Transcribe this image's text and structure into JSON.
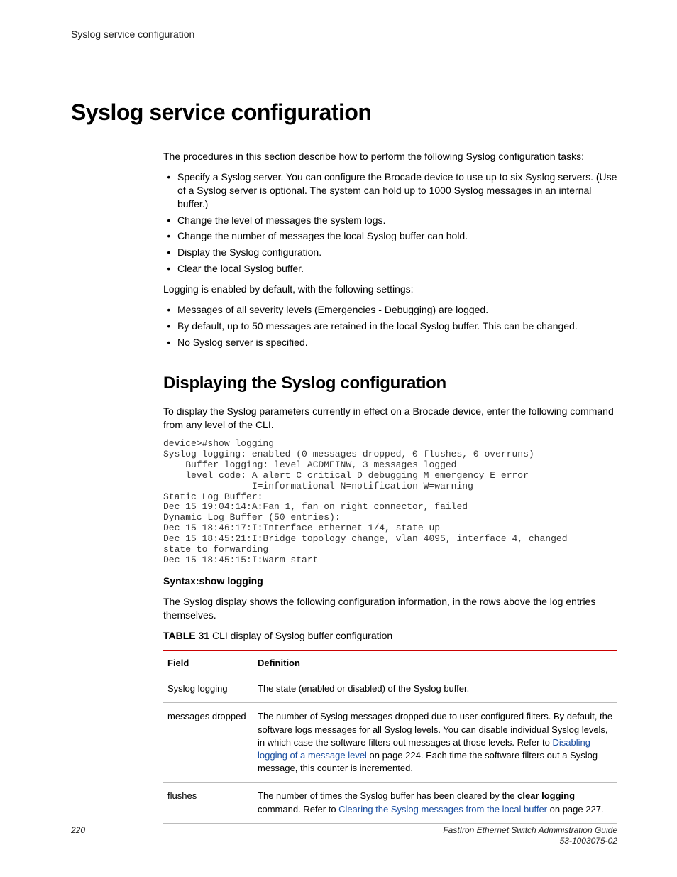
{
  "running_header": "Syslog service configuration",
  "h1": "Syslog service configuration",
  "intro": "The procedures in this section describe how to perform the following Syslog configuration tasks:",
  "tasks": [
    "Specify a Syslog server. You can configure the Brocade device to use up to six Syslog servers. (Use of a Syslog server is optional. The system can hold up to 1000 Syslog messages in an internal buffer.)",
    "Change the level of messages the system logs.",
    "Change the number of messages the local Syslog buffer can hold.",
    "Display the Syslog configuration.",
    "Clear the local Syslog buffer."
  ],
  "defaults_lead": "Logging is enabled by default, with the following settings:",
  "defaults": [
    "Messages of all severity levels (Emergencies - Debugging) are logged.",
    "By default, up to 50 messages are retained in the local Syslog buffer. This can be changed.",
    "No Syslog server is specified."
  ],
  "h2": "Displaying the Syslog configuration",
  "display_intro": "To display the Syslog parameters currently in effect on a Brocade device, enter the following command from any level of the CLI.",
  "code": "device>#show logging\nSyslog logging: enabled (0 messages dropped, 0 flushes, 0 overruns)\n    Buffer logging: level ACDMEINW, 3 messages logged\n    level code: A=alert C=critical D=debugging M=emergency E=error\n                I=informational N=notification W=warning\nStatic Log Buffer:\nDec 15 19:04:14:A:Fan 1, fan on right connector, failed\nDynamic Log Buffer (50 entries):\nDec 15 18:46:17:I:Interface ethernet 1/4, state up\nDec 15 18:45:21:I:Bridge topology change, vlan 4095, interface 4, changed\nstate to forwarding\nDec 15 18:45:15:I:Warm start",
  "syntax_label": "Syntax:",
  "syntax_cmd": "show logging",
  "after_syntax": "The Syslog display shows the following configuration information, in the rows above the log entries themselves.",
  "table_label": "TABLE 31 ",
  "table_caption": "CLI display of Syslog buffer configuration",
  "table_headers": {
    "field": "Field",
    "definition": "Definition"
  },
  "rows": {
    "r1": {
      "field": "Syslog logging",
      "def": "The state (enabled or disabled) of the Syslog buffer."
    },
    "r2": {
      "field": "messages dropped",
      "def_pre": "The number of Syslog messages dropped due to user-configured filters. By default, the software logs messages for all Syslog levels. You can disable individual Syslog levels, in which case the software filters out messages at those levels. Refer to ",
      "def_link": "Disabling logging of a message level",
      "def_post": " on page 224. Each time the software filters out a Syslog message, this counter is incremented."
    },
    "r3": {
      "field": "flushes",
      "def_pre": "The number of times the Syslog buffer has been cleared by the ",
      "def_bold": "clear logging",
      "def_mid": " command. Refer to ",
      "def_link": "Clearing the Syslog messages from the local buffer",
      "def_post": " on page 227."
    }
  },
  "footer": {
    "page": "220",
    "doc_title": "FastIron Ethernet Switch Administration Guide",
    "doc_num": "53-1003075-02"
  }
}
